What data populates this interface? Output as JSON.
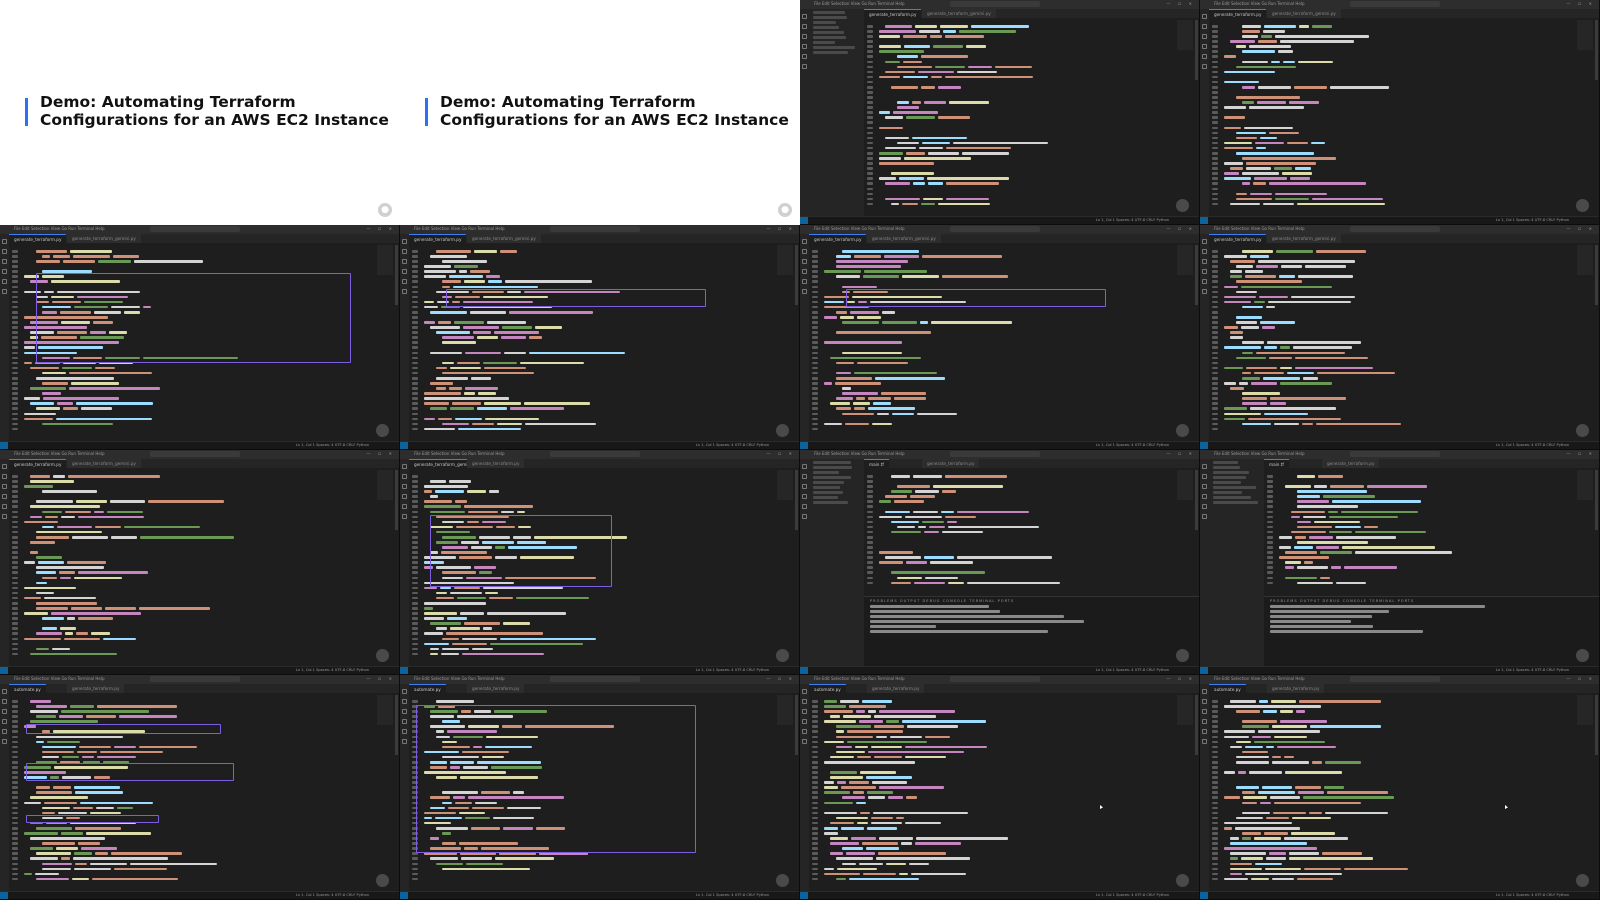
{
  "slides": [
    {
      "title_line1": "Demo: Automating Terraform",
      "title_line2": "Configurations for an AWS EC2 Instance"
    },
    {
      "title_line1": "Demo: Automating Terraform",
      "title_line2": "Configurations for an AWS EC2 Instance"
    }
  ],
  "editor": {
    "menu": "File  Edit  Selection  View  Go  Run  Terminal  Help",
    "window_controls": "— ☐ ✕",
    "status_text": "Ln 1, Col 1  Spaces: 4  UTF-8  CRLF  Python",
    "terminal_tabs": "PROBLEMS  OUTPUT  DEBUG CONSOLE  TERMINAL  PORTS",
    "tabs": {
      "generate_terraform": "generate_terraform.py",
      "generate_terraform_gemini": "generate_terraform_gemini.py",
      "main_tf": "main.tf",
      "automate": "automate.py"
    }
  },
  "colors": {
    "accent_bar": "#2b6fff",
    "highlight_box": "#7e5ee0",
    "editor_bg": "#1e1e1e"
  }
}
